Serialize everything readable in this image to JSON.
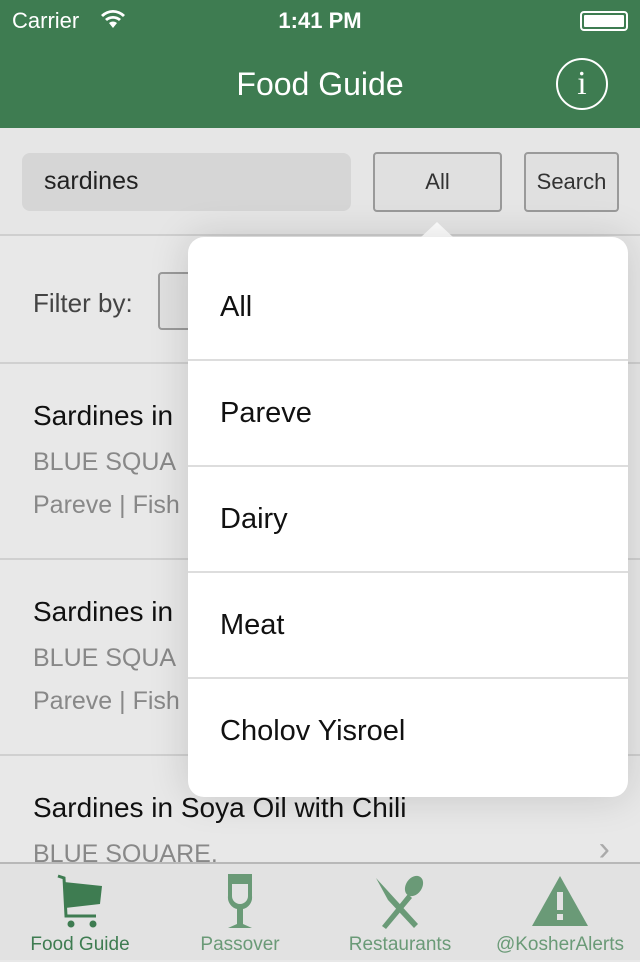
{
  "status": {
    "carrier": "Carrier",
    "time": "1:41 PM"
  },
  "nav": {
    "title": "Food Guide",
    "info_icon": "info-icon",
    "info_glyph": "i"
  },
  "search": {
    "value": "sardines",
    "category_button": "All",
    "search_button": "Search"
  },
  "filter": {
    "label": "Filter by:"
  },
  "results": [
    {
      "name": "Sardines in",
      "brand": "BLUE SQUA",
      "tags": "Pareve | Fish"
    },
    {
      "name": "Sardines in",
      "brand": "BLUE SQUA",
      "tags": "Pareve | Fish"
    },
    {
      "name": "Sardines in Soya Oil with Chili",
      "brand": "BLUE SQUARE.",
      "tags": ""
    }
  ],
  "popover": {
    "options": [
      "All",
      "Pareve",
      "Dairy",
      "Meat",
      "Cholov Yisroel"
    ]
  },
  "tabs": [
    {
      "label": "Food Guide",
      "icon": "cart-icon",
      "active": true
    },
    {
      "label": "Passover",
      "icon": "wine-glass-icon"
    },
    {
      "label": "Restaurants",
      "icon": "fork-spoon-icon"
    },
    {
      "label": "@KosherAlerts",
      "icon": "warning-icon"
    }
  ],
  "colors": {
    "brand": "#3e7c51",
    "tab_inactive": "#6a9a77"
  }
}
